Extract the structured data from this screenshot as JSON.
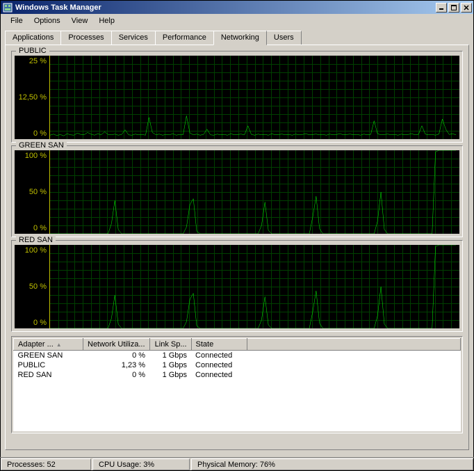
{
  "window": {
    "title": "Windows Task Manager"
  },
  "menu": {
    "file": "File",
    "options": "Options",
    "view": "View",
    "help": "Help"
  },
  "tabs": {
    "applications": "Applications",
    "processes": "Processes",
    "services": "Services",
    "performance": "Performance",
    "networking": "Networking",
    "users": "Users"
  },
  "graphs": [
    {
      "name": "PUBLIC",
      "ylabels": [
        "25 %",
        "12,50 %",
        "0 %"
      ],
      "ymax": 25
    },
    {
      "name": "GREEN SAN",
      "ylabels": [
        "100 %",
        "50 %",
        "0 %"
      ],
      "ymax": 100
    },
    {
      "name": "RED SAN",
      "ylabels": [
        "100 %",
        "50 %",
        "0 %"
      ],
      "ymax": 100
    }
  ],
  "table": {
    "headers": {
      "adapter": "Adapter ...",
      "util": "Network Utiliza...",
      "speed": "Link Sp...",
      "state": "State"
    },
    "rows": [
      {
        "adapter": "GREEN SAN",
        "util": "0 %",
        "speed": "1 Gbps",
        "state": "Connected"
      },
      {
        "adapter": "PUBLIC",
        "util": "1,23 %",
        "speed": "1 Gbps",
        "state": "Connected"
      },
      {
        "adapter": "RED SAN",
        "util": "0 %",
        "speed": "1 Gbps",
        "state": "Connected"
      }
    ]
  },
  "status": {
    "processes": "Processes: 52",
    "cpu": "CPU Usage: 3%",
    "mem": "Physical Memory: 76%"
  },
  "chart_data": [
    {
      "type": "line",
      "name": "PUBLIC",
      "ylim": [
        0,
        25
      ],
      "ylabel": "%",
      "values": [
        1.2,
        1.5,
        1.1,
        1.4,
        1.0,
        1.6,
        1.3,
        1.2,
        1.8,
        1.4,
        1.3,
        2.0,
        1.5,
        1.2,
        1.6,
        1.3,
        2.2,
        1.4,
        1.3,
        1.5,
        1.2,
        1.4,
        2.8,
        1.3,
        1.2,
        1.5,
        1.3,
        1.4,
        1.2,
        6.5,
        2.0,
        1.3,
        1.5,
        1.2,
        1.4,
        1.3,
        1.6,
        1.2,
        1.4,
        1.3,
        7.0,
        1.8,
        1.3,
        1.5,
        1.2,
        1.4,
        3.0,
        1.3,
        1.2,
        1.5,
        1.3,
        1.4,
        1.2,
        1.6,
        1.3,
        1.4,
        1.5,
        1.3,
        4.0,
        1.4,
        1.2,
        1.5,
        1.3,
        1.4,
        1.2,
        1.6,
        1.3,
        1.4,
        1.5,
        1.3,
        1.4,
        1.2,
        1.5,
        1.3,
        1.4,
        1.6,
        1.3,
        1.4,
        1.5,
        1.3,
        1.4,
        1.2,
        1.5,
        1.3,
        1.4,
        1.6,
        1.3,
        1.4,
        1.5,
        1.3,
        1.4,
        1.2,
        1.5,
        1.3,
        1.4,
        5.5,
        1.6,
        1.3,
        1.4,
        1.5,
        1.3,
        1.4,
        1.2,
        1.5,
        1.3,
        1.4,
        1.6,
        1.3,
        1.4,
        4.0,
        1.5,
        1.3,
        1.4,
        1.2,
        1.5,
        6.0,
        3.0,
        1.4,
        1.6,
        1.3
      ]
    },
    {
      "type": "line",
      "name": "GREEN SAN",
      "ylim": [
        0,
        100
      ],
      "ylabel": "%",
      "values": [
        0,
        0,
        0,
        0,
        0,
        0,
        0,
        0,
        0,
        0,
        0,
        0,
        0,
        0,
        0,
        0,
        0,
        0,
        12,
        40,
        5,
        0,
        0,
        0,
        0,
        0,
        0,
        0,
        0,
        0,
        0,
        0,
        0,
        0,
        0,
        0,
        0,
        0,
        0,
        0,
        8,
        35,
        42,
        3,
        0,
        0,
        0,
        0,
        0,
        0,
        0,
        0,
        0,
        0,
        0,
        0,
        0,
        0,
        0,
        0,
        0,
        0,
        10,
        38,
        4,
        0,
        0,
        0,
        0,
        0,
        0,
        0,
        0,
        0,
        0,
        0,
        0,
        20,
        45,
        6,
        0,
        0,
        0,
        0,
        0,
        0,
        0,
        0,
        0,
        0,
        0,
        0,
        0,
        0,
        0,
        0,
        15,
        50,
        5,
        0,
        0,
        0,
        0,
        0,
        0,
        0,
        0,
        0,
        0,
        0,
        0,
        0,
        0,
        98,
        100,
        100,
        100,
        100,
        100,
        100
      ]
    },
    {
      "type": "line",
      "name": "RED SAN",
      "ylim": [
        0,
        100
      ],
      "ylabel": "%",
      "values": [
        0,
        0,
        0,
        0,
        0,
        0,
        0,
        0,
        0,
        0,
        0,
        0,
        0,
        0,
        0,
        0,
        0,
        0,
        12,
        40,
        5,
        0,
        0,
        0,
        0,
        0,
        0,
        0,
        0,
        0,
        0,
        0,
        0,
        0,
        0,
        0,
        0,
        0,
        0,
        0,
        8,
        35,
        42,
        3,
        0,
        0,
        0,
        0,
        0,
        0,
        0,
        0,
        0,
        0,
        0,
        0,
        0,
        0,
        0,
        0,
        0,
        0,
        10,
        38,
        4,
        0,
        0,
        0,
        0,
        0,
        0,
        0,
        0,
        0,
        0,
        0,
        0,
        20,
        45,
        6,
        0,
        0,
        0,
        0,
        0,
        0,
        0,
        0,
        0,
        0,
        0,
        0,
        0,
        0,
        0,
        0,
        15,
        50,
        5,
        0,
        0,
        0,
        0,
        0,
        0,
        0,
        0,
        0,
        0,
        0,
        0,
        0,
        0,
        98,
        100,
        100,
        100,
        100,
        100,
        100
      ]
    }
  ]
}
